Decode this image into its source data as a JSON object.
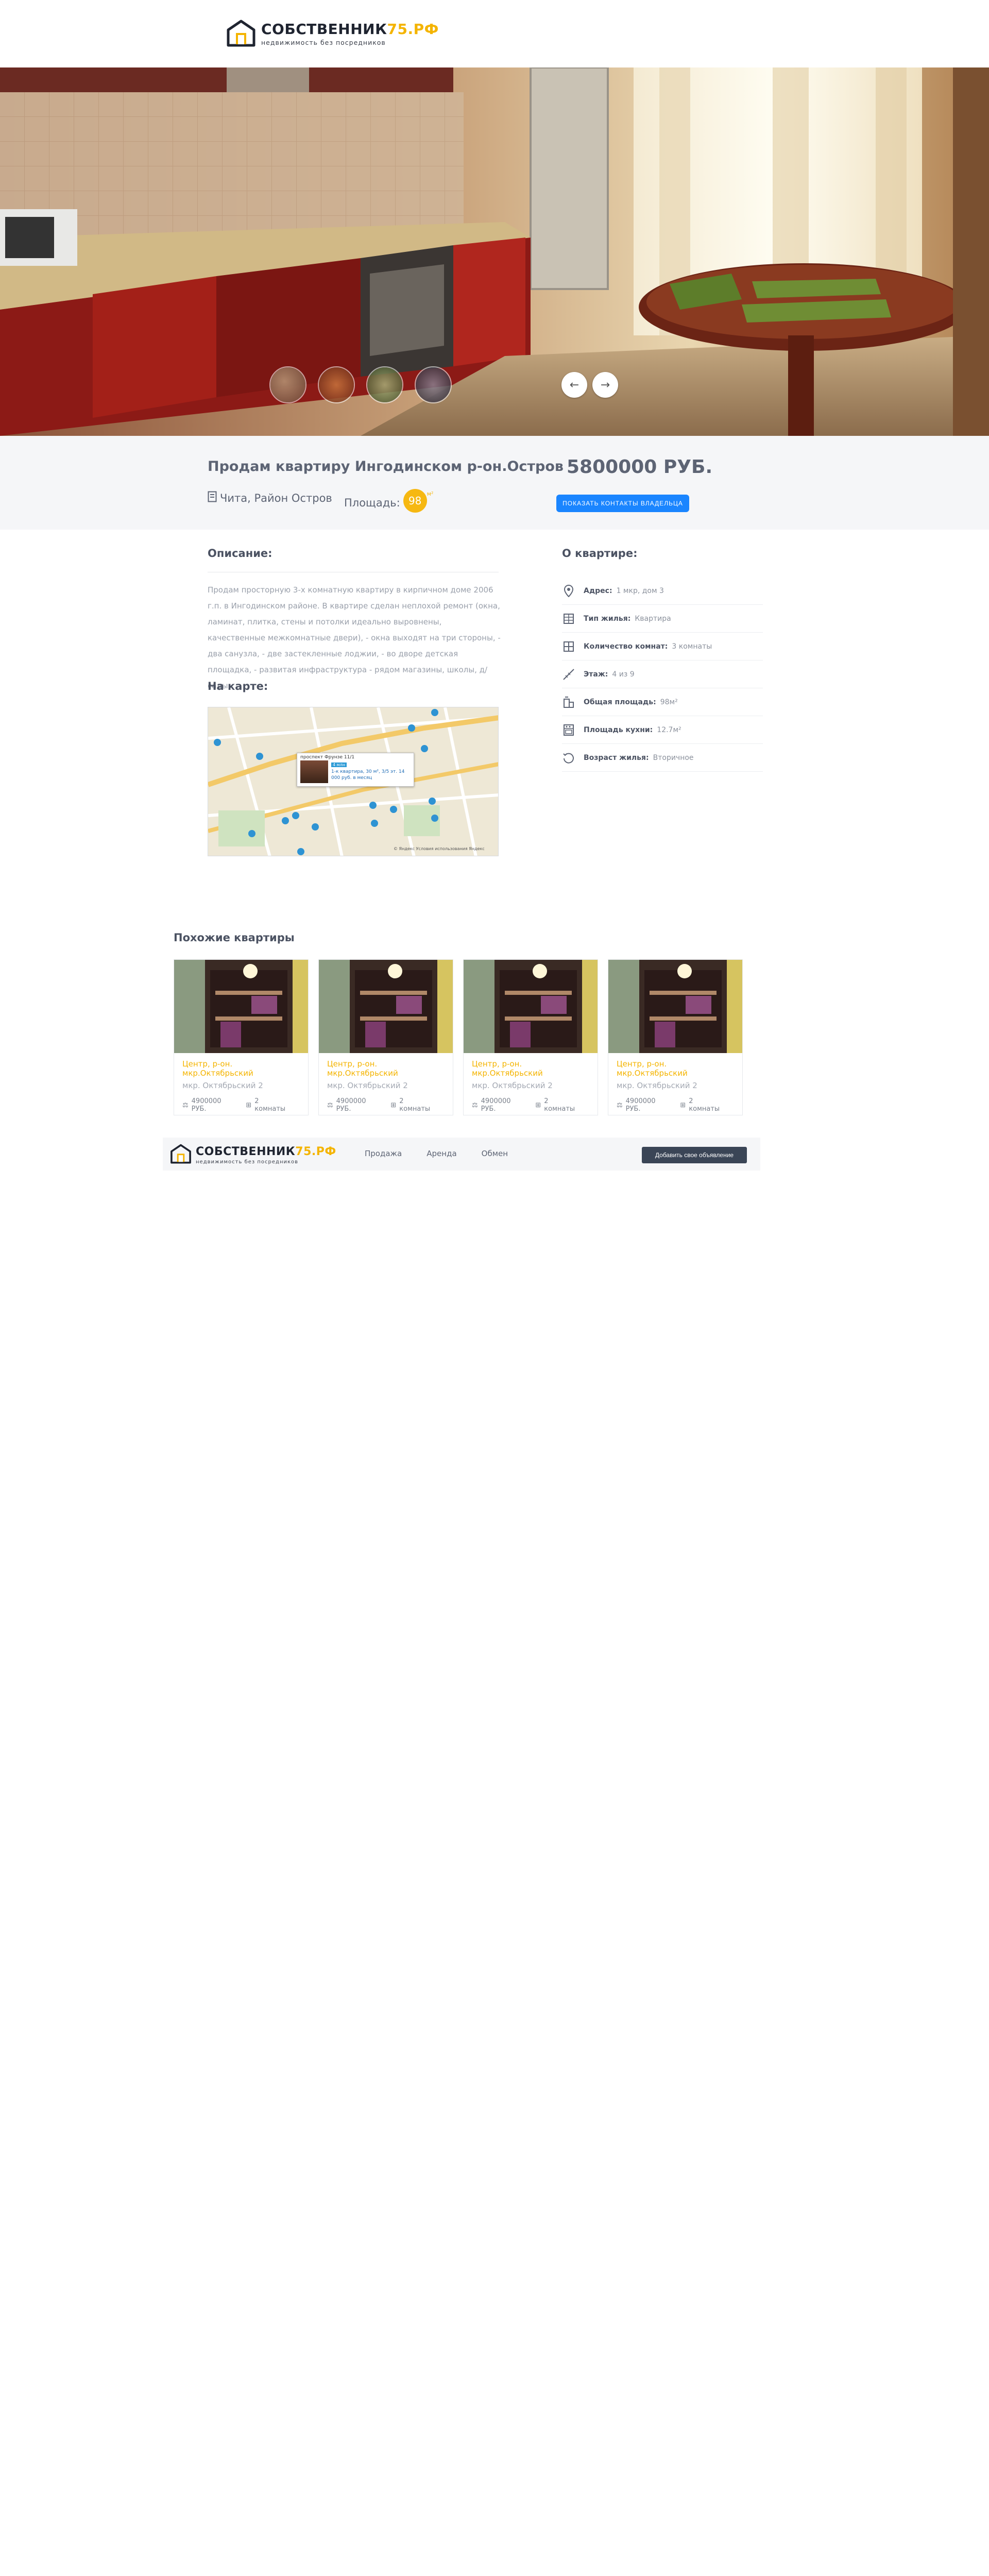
{
  "header": {
    "logo_title_main": "СОБСТВЕННИК",
    "logo_title_accent": "75.РФ",
    "logo_subtitle": "недвижимость без посредников"
  },
  "gallery": {
    "prev_icon": "arrow-left-icon",
    "next_icon": "arrow-right-icon",
    "thumbnails": [
      "thumb-1",
      "thumb-2",
      "thumb-3",
      "thumb-4"
    ]
  },
  "listing": {
    "title": "Продам квартиру Ингодинском р-он.Остров",
    "price": "5800000 РУБ.",
    "location": "Чита, Район Остров",
    "area_label": "Площадь:",
    "area_value": "98",
    "area_unit": "м²",
    "contact_button": "ПОКАЗАТЬ КОНТАКТЫ ВЛАДЕЛЬЦА"
  },
  "description": {
    "heading": "Описание:",
    "text": "Продам просторную 3-х комнатную квартиру в кирпичном доме 2006 г.п. в Ингодинском районе. В квартире сделан неплохой ремонт (окна, ламинат, плитка, стены и потолки идеально выровнены, качественные межкомнатные двери), - окна выходят на три стороны, - два санузла, - две застекленные лоджии, - во дворе детская площадка, - развитая инфраструктура - рядом магазины, школы, д/сады."
  },
  "map": {
    "heading": "На карте:",
    "popup_title": "проспект Фрунзе 11/1",
    "popup_tag": "4 млн",
    "popup_text": "1-к квартира, 30 м², 3/5 эт. 14 000 руб. в месяц",
    "credit": "© Яндекс  Условия использования  Яндекс"
  },
  "about": {
    "heading": "О квартире:",
    "rows": [
      {
        "icon": "location-pin-icon",
        "label": "Адрес:",
        "value": "1 мкр, дом 3"
      },
      {
        "icon": "building-icon",
        "label": "Тип жилья:",
        "value": "Квартира"
      },
      {
        "icon": "rooms-grid-icon",
        "label": "Количество комнат:",
        "value": "3 комнаты"
      },
      {
        "icon": "stairs-icon",
        "label": "Этаж:",
        "value": "4 из 9"
      },
      {
        "icon": "area-icon",
        "label": "Общая площадь:",
        "value": "98м²"
      },
      {
        "icon": "kitchen-icon",
        "label": "Площадь кухни:",
        "value": "12.7м²"
      },
      {
        "icon": "history-icon",
        "label": "Возраст жилья:",
        "value": "Вторичное"
      }
    ]
  },
  "similar": {
    "heading": "Похожие квартиры",
    "cards": [
      {
        "title": "Центр, р-он. мкр.Октябрьский",
        "address": "мкр. Октябрьский 2",
        "price": "4900000 РУБ.",
        "rooms": "2 комнаты"
      },
      {
        "title": "Центр, р-он. мкр.Октябрьский",
        "address": "мкр. Октябрьский 2",
        "price": "4900000 РУБ.",
        "rooms": "2 комнаты"
      },
      {
        "title": "Центр, р-он. мкр.Октябрьский",
        "address": "мкр. Октябрьский 2",
        "price": "4900000 РУБ.",
        "rooms": "2 комнаты"
      },
      {
        "title": "Центр, р-он. мкр.Октябрьский",
        "address": "мкр. Октябрьский 2",
        "price": "4900000 РУБ.",
        "rooms": "2 комнаты"
      }
    ]
  },
  "footer": {
    "nav": [
      "Продажа",
      "Аренда",
      "Обмен"
    ],
    "add_button": "Добавить свое объявление"
  },
  "colors": {
    "accent": "#f4b400",
    "primary_button": "#1a85ff",
    "dark_button": "#3a4556",
    "band_bg": "#f5f6f8"
  }
}
